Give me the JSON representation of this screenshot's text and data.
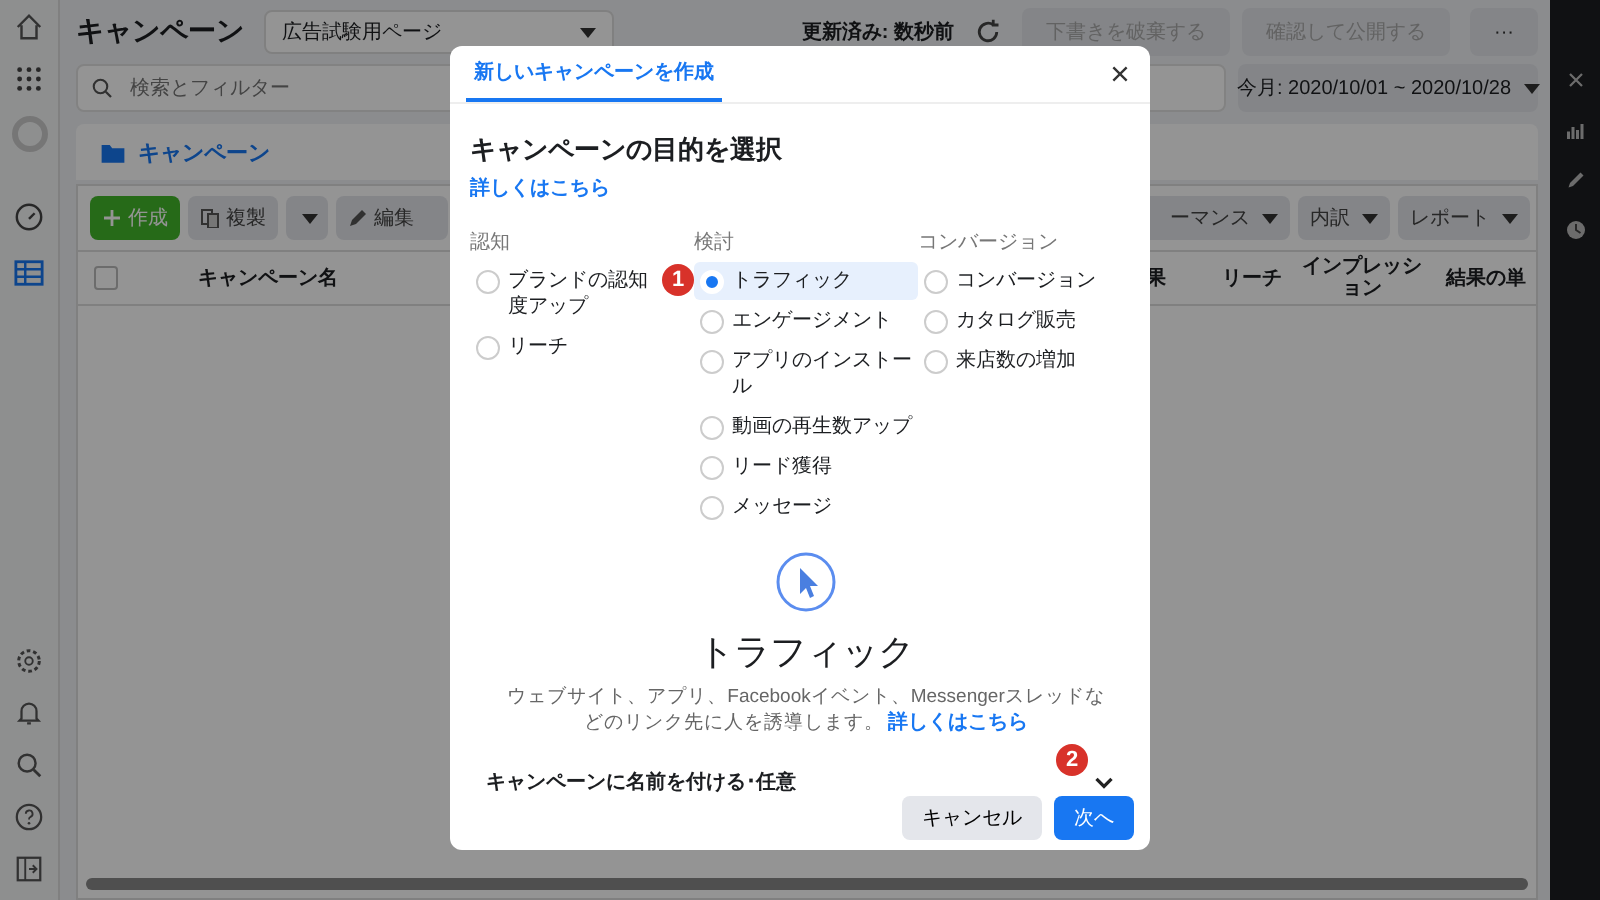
{
  "header": {
    "title": "キャンペーン",
    "page_select": "広告試験用ページ",
    "updated": "更新済み: 数秒前",
    "buttons": [
      "下書きを破棄する",
      "確認して公開する",
      "···"
    ]
  },
  "filter_bar": {
    "search_placeholder": "検索とフィルター",
    "date_range": "今月: 2020/10/01 ~ 2020/10/28"
  },
  "level_tab": "キャンペーン",
  "toolbar": {
    "create": "作成",
    "duplicate": "複製",
    "edit": "編集",
    "right": [
      "ーマンス",
      "内訳",
      "レポート"
    ]
  },
  "table": {
    "select_all": {
      "checked": false
    },
    "columns": [
      "キャンペーン名",
      "果",
      "リーチ",
      "インプレッション",
      "結果の単"
    ]
  },
  "dialog": {
    "tab": "新しいキャンペーンを作成",
    "heading": "キャンペーンの目的を選択",
    "learn_more": "詳しくはこちら",
    "groups": [
      {
        "label": "認知",
        "options": [
          {
            "label": "ブランドの認知度アップ",
            "selected": false
          },
          {
            "label": "リーチ",
            "selected": false
          }
        ]
      },
      {
        "label": "検討",
        "options": [
          {
            "label": "トラフィック",
            "selected": true,
            "badge": "1"
          },
          {
            "label": "エンゲージメント",
            "selected": false
          },
          {
            "label": "アプリのインストール",
            "selected": false
          },
          {
            "label": "動画の再生数アップ",
            "selected": false
          },
          {
            "label": "リード獲得",
            "selected": false
          },
          {
            "label": "メッセージ",
            "selected": false
          }
        ]
      },
      {
        "label": "コンバージョン",
        "options": [
          {
            "label": "コンバージョン",
            "selected": false
          },
          {
            "label": "カタログ販売",
            "selected": false
          },
          {
            "label": "来店数の増加",
            "selected": false
          }
        ]
      }
    ],
    "detail": {
      "title": "トラフィック",
      "description": "ウェブサイト、アプリ、Facebookイベント、Messengerスレッドなどのリンク先に人を誘導します。",
      "link": "詳しくはこちら"
    },
    "name_section": {
      "label": "キャンペーンに名前を付ける･任意",
      "expanded": false
    },
    "cancel": "キャンセル",
    "next": "次へ",
    "next_badge": "2"
  }
}
